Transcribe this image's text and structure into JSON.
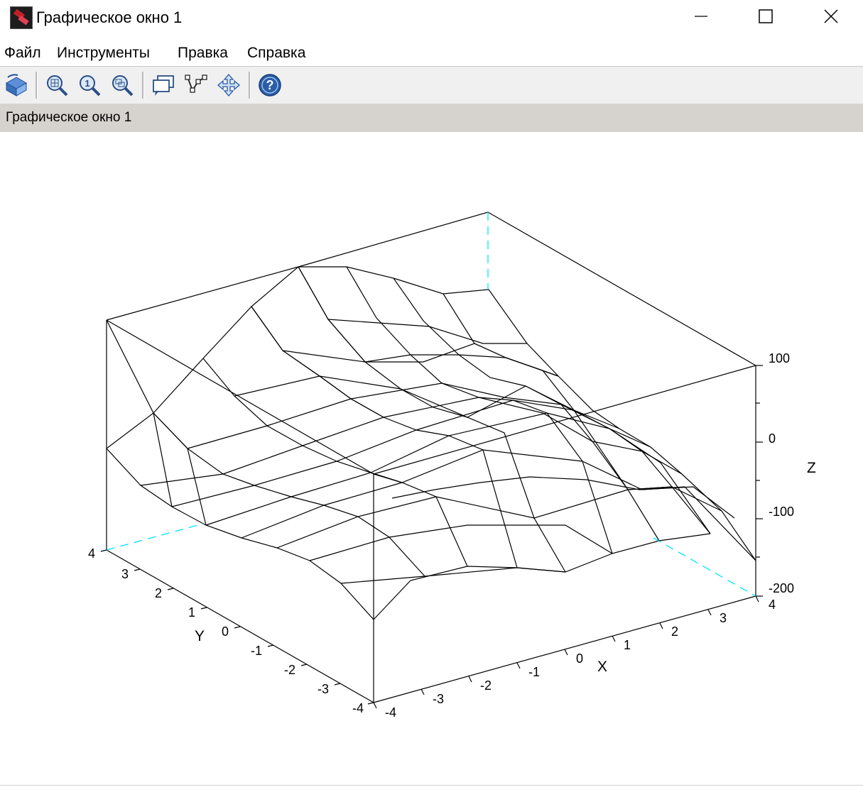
{
  "window": {
    "title": "Графическое окно 1"
  },
  "menu": {
    "items": [
      "Файл",
      "Инструменты",
      "Правка",
      "Справка"
    ]
  },
  "toolbar": {
    "icons": [
      "rotate-icon",
      "zoom-area-icon",
      "zoom-reset-icon",
      "zoom-out-icon",
      "datatip-icon",
      "data-edit-icon",
      "pan-icon",
      "help-icon"
    ]
  },
  "tab": {
    "title": "Графическое окно 1"
  },
  "chart_data": {
    "type": "surface3d",
    "x_axis": {
      "label": "X",
      "ticks": [
        "-4",
        "-3",
        "-2",
        "-1",
        "0",
        "1",
        "2",
        "3",
        "4"
      ],
      "range": [
        -4,
        4
      ]
    },
    "y_axis": {
      "label": "Y",
      "ticks": [
        "-4",
        "-3",
        "-2",
        "-1",
        "0",
        "1",
        "2",
        "3",
        "4"
      ],
      "range": [
        -4,
        4
      ]
    },
    "z_axis": {
      "label": "Z",
      "ticks": [
        "-200",
        "-100",
        "0",
        "100"
      ],
      "range": [
        -200,
        100
      ]
    },
    "grid": "8x8 wireframe mesh",
    "colors": {
      "mesh": "#000000",
      "hidden_edges": "#00e5ff",
      "background": "#ffffff"
    }
  }
}
